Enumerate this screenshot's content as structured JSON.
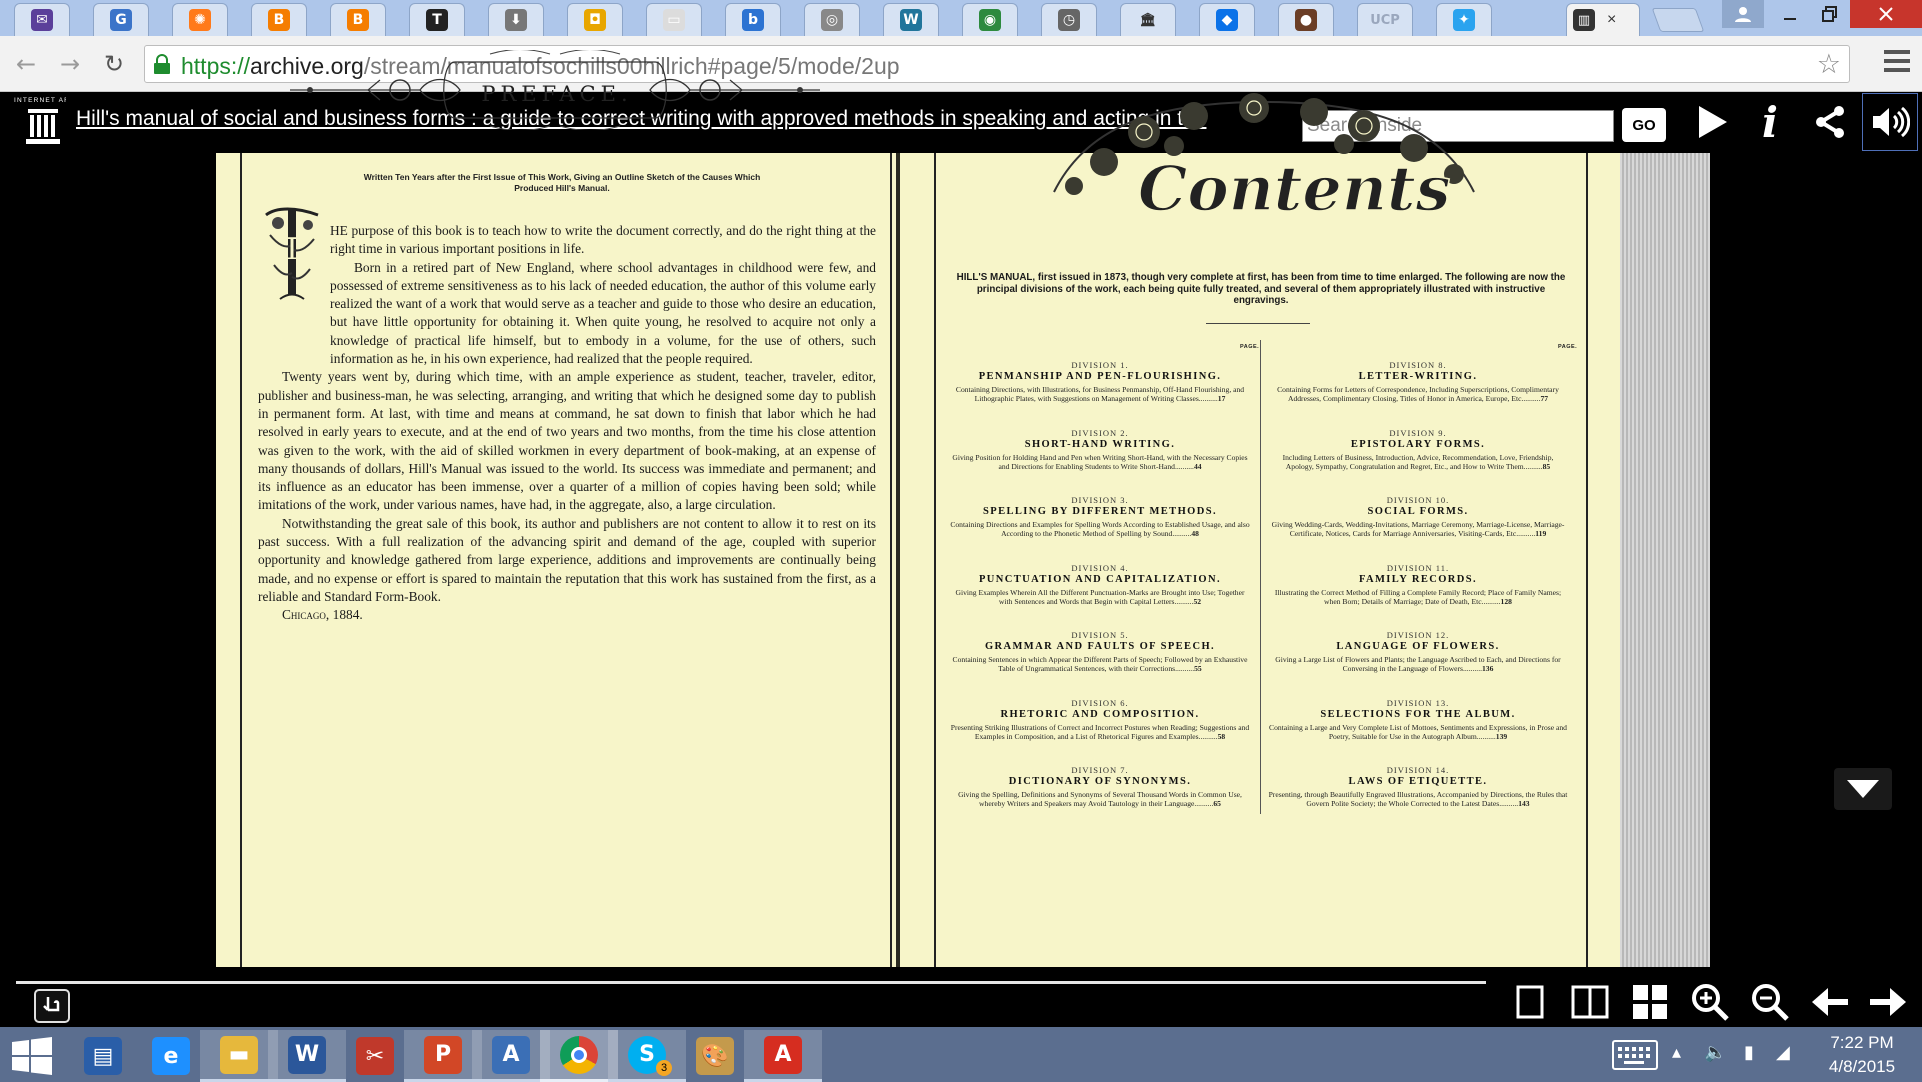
{
  "browser": {
    "tabs": [
      {
        "icon": "mail-icon",
        "color": "#5b3f9a",
        "glyph": "✉"
      },
      {
        "icon": "google-search-icon",
        "color": "#3b74c9",
        "glyph": "G"
      },
      {
        "icon": "sun-icon",
        "color": "#ff7a1a",
        "glyph": "✺"
      },
      {
        "icon": "blogger-icon",
        "color": "#f57d00",
        "glyph": "B"
      },
      {
        "icon": "blogger-icon",
        "color": "#f57d00",
        "glyph": "B"
      },
      {
        "icon": "nyt-icon",
        "color": "#222222",
        "glyph": "T"
      },
      {
        "icon": "download-icon",
        "color": "#777777",
        "glyph": "⬇"
      },
      {
        "icon": "bookmark-icon",
        "color": "#e8a600",
        "glyph": "◘"
      },
      {
        "icon": "document-icon",
        "color": "#dcdcdc",
        "glyph": "▭"
      },
      {
        "icon": "b-app-icon",
        "color": "#2c73d2",
        "glyph": "b"
      },
      {
        "icon": "circle-icon",
        "color": "#888888",
        "glyph": "◎"
      },
      {
        "icon": "wordpress-icon",
        "color": "#21759b",
        "glyph": "W"
      },
      {
        "icon": "globe-icon",
        "color": "#2d8a3e",
        "glyph": "◉"
      },
      {
        "icon": "clock-icon",
        "color": "#666666",
        "glyph": "◷"
      },
      {
        "icon": "archive-icon",
        "color": "#333333",
        "glyph": "🏛"
      },
      {
        "icon": "dropbox-icon",
        "color": "#0b72e8",
        "glyph": "◆"
      },
      {
        "icon": "coffee-icon",
        "color": "#6b3e26",
        "glyph": "●"
      },
      {
        "icon": "ucp-icon",
        "color": "#9aa7bd",
        "glyph": "UCP"
      },
      {
        "icon": "twitter-icon",
        "color": "#2aa3ef",
        "glyph": "✦"
      }
    ],
    "active_tab_icon": "archive-icon",
    "active_tab_close": "×",
    "url_scheme": "https://",
    "url_host": "archive.org",
    "url_path": "/stream/manualofsochills00hillrich#page/5/mode/2up"
  },
  "ia": {
    "logo_text": "INTERNET ARCHIVE",
    "title": "Hill's manual of social and business forms : a guide to correct writing with approved methods in speaking and acting in the",
    "search_placeholder": "Search inside",
    "go_label": "GO"
  },
  "left_page": {
    "heading": "PREFACE.",
    "subtitle": "Written Ten Years after the First Issue of This Work, Giving an Outline Sketch of the Causes Which Produced Hill's Manual.",
    "dropcap": "T",
    "para1": "HE purpose of this book is to teach how to write the document correctly, and do the right thing at the right time in various important positions in life.",
    "para2": "Born in a retired part of New England, where school advantages in childhood were few, and possessed of extreme sensitiveness as to his lack of needed education, the author of this volume early realized the want of a work that would serve as a teacher and guide to those who desire an education, but have little opportunity for obtaining it. When quite young, he resolved to acquire not only a knowledge of practical life himself, but to embody in a volume, for the use of others, such information as he, in his own experience, had realized that the people required.",
    "para3": "Twenty years went by, during which time, with an ample experience as student, teacher, traveler, editor, publisher and business-man, he was selecting, arranging, and writing that which he designed some day to publish in permanent form. At last, with time and means at command, he sat down to finish that labor which he had resolved in early years to execute, and at the end of two years and two months, from the time his close attention was given to the work, with the aid of skilled workmen in every department of book-making, at an expense of many thousands of dollars, Hill's Manual was issued to the world. Its success was immediate and permanent; and its influence as an educator has been immense, over a quarter of a million of copies having been sold; while imitations of the work, under various names, have had, in the aggregate, also, a large circulation.",
    "para4": "Notwithstanding the great sale of this book, its author and publishers are not content to allow it to rest on its past success. With a full realization of the advancing spirit and demand of the age, coupled with superior opportunity and knowledge gathered from large experience, additions and improvements are continually being made, and no expense or effort is spared to maintain the reputation that this work has sustained from the first, as a reliable and Standard Form-Book.",
    "signature": "Chicago, 1884."
  },
  "right_page": {
    "heading": "Contents",
    "intro": "HILL'S MANUAL, first issued in 1873, though very complete at first, has been from time to time enlarged. The following are now the principal divisions of the work, each being quite fully treated, and several of them appropriately illustrated with instructive engravings.",
    "page_label": "PAGE.",
    "left_col": [
      {
        "division": "DIVISION 1.",
        "title": "PENMANSHIP AND PEN-FLOURISHING.",
        "desc": "Containing Directions, with Illustrations, for Business Penmanship, Off-Hand Flourishing, and Lithographic Plates, with Suggestions on Management of Writing Classes",
        "page": "17"
      },
      {
        "division": "DIVISION 2.",
        "title": "SHORT-HAND WRITING.",
        "desc": "Giving Position for Holding Hand and Pen when Writing Short-Hand, with the Necessary Copies and Directions for Enabling Students to Write Short-Hand",
        "page": "44"
      },
      {
        "division": "DIVISION 3.",
        "title": "SPELLING BY DIFFERENT METHODS.",
        "desc": "Containing Directions and Examples for Spelling Words According to Established Usage, and also According to the Phonetic Method of Spelling by Sound",
        "page": "48"
      },
      {
        "division": "DIVISION 4.",
        "title": "PUNCTUATION AND CAPITALIZATION.",
        "desc": "Giving Examples Wherein All the Different Punctuation-Marks are Brought into Use; Together with Sentences and Words that Begin with Capital Letters",
        "page": "52"
      },
      {
        "division": "DIVISION 5.",
        "title": "GRAMMAR AND FAULTS OF SPEECH.",
        "desc": "Containing Sentences in which Appear the Different Parts of Speech; Followed by an Exhaustive Table of Ungrammatical Sentences, with their Corrections",
        "page": "55"
      },
      {
        "division": "DIVISION 6.",
        "title": "RHETORIC AND COMPOSITION.",
        "desc": "Presenting Striking Illustrations of Correct and Incorrect Postures when Reading; Suggestions and Examples in Composition, and a List of Rhetorical Figures and Examples",
        "page": "58"
      },
      {
        "division": "DIVISION 7.",
        "title": "DICTIONARY OF SYNONYMS.",
        "desc": "Giving the Spelling, Definitions and Synonyms of Several Thousand Words in Common Use, whereby Writers and Speakers may Avoid Tautology in their Language",
        "page": "65"
      }
    ],
    "right_col": [
      {
        "division": "DIVISION 8.",
        "title": "LETTER-WRITING.",
        "desc": "Containing Forms for Letters of Correspondence, Including Superscriptions, Complimentary Addresses, Complimentary Closing, Titles of Honor in America, Europe, Etc",
        "page": "77"
      },
      {
        "division": "DIVISION 9.",
        "title": "EPISTOLARY FORMS.",
        "desc": "Including Letters of Business, Introduction, Advice, Recommendation, Love, Friendship, Apology, Sympathy, Congratulation and Regret, Etc., and How to Write Them",
        "page": "85"
      },
      {
        "division": "DIVISION 10.",
        "title": "SOCIAL FORMS.",
        "desc": "Giving Wedding-Cards, Wedding-Invitations, Marriage Ceremony, Marriage-License, Marriage-Certificate, Notices, Cards for Marriage Anniversaries, Visiting-Cards, Etc",
        "page": "119"
      },
      {
        "division": "DIVISION 11.",
        "title": "FAMILY RECORDS.",
        "desc": "Illustrating the Correct Method of Filling a Complete Family Record; Place of Family Names; when Born; Details of Marriage; Date of Death, Etc",
        "page": "128"
      },
      {
        "division": "DIVISION 12.",
        "title": "LANGUAGE OF FLOWERS.",
        "desc": "Giving a Large List of Flowers and Plants; the Language Ascribed to Each, and Directions for Conversing in the Language of Flowers",
        "page": "136"
      },
      {
        "division": "DIVISION 13.",
        "title": "SELECTIONS FOR THE ALBUM.",
        "desc": "Containing a Large and Very Complete List of Mottoes, Sentiments and Expressions, in Prose and Poetry, Suitable for Use in the Autograph Album",
        "page": "139"
      },
      {
        "division": "DIVISION 14.",
        "title": "LAWS OF ETIQUETTE.",
        "desc": "Presenting, through Beautifully Engraved Illustrations, Accompanied by Directions, the Rules that Govern Polite Society; the Whole Corrected to the Latest Dates",
        "page": "143"
      }
    ]
  },
  "nav": {
    "icons": [
      "single-page-view-icon",
      "two-page-view-icon",
      "thumbnail-view-icon",
      "zoom-in-icon",
      "zoom-out-icon",
      "previous-page-icon",
      "next-page-icon"
    ]
  },
  "taskbar": {
    "apps": [
      {
        "name": "server-manager-icon",
        "color": "#2a5ea8"
      },
      {
        "name": "internet-explorer-icon",
        "color": "#1e90ff"
      },
      {
        "name": "file-explorer-icon",
        "color": "#e6b83c"
      },
      {
        "name": "word-icon",
        "color": "#2b579a"
      },
      {
        "name": "snipping-tool-icon",
        "color": "#c0392b"
      },
      {
        "name": "powerpoint-icon",
        "color": "#d24726"
      },
      {
        "name": "address-book-icon",
        "color": "#3b6fb6"
      },
      {
        "name": "chrome-icon",
        "color": "#4285f4"
      },
      {
        "name": "skype-icon",
        "color": "#00aff0"
      },
      {
        "name": "paint-icon",
        "color": "#c49a4c"
      },
      {
        "name": "acrobat-icon",
        "color": "#d62d20"
      }
    ],
    "skype_badge": "3",
    "time": "7:22 PM",
    "date": "4/8/2015"
  }
}
